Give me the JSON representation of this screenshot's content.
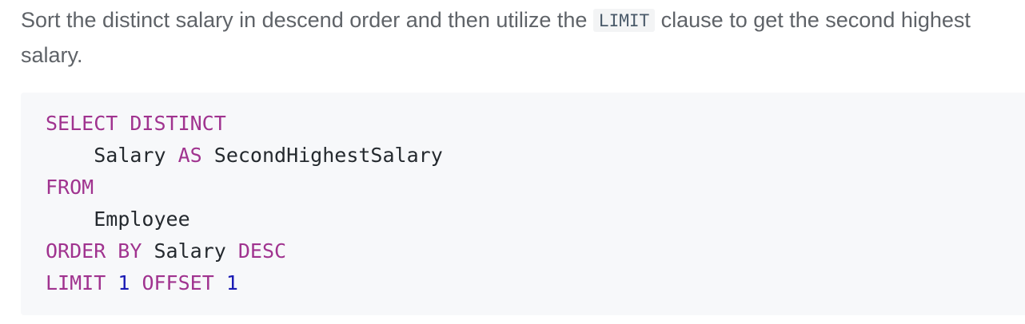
{
  "description": {
    "text_before": "Sort the distinct salary in descend order and then utilize the ",
    "inline_code": "LIMIT",
    "text_after": " clause to get the second highest salary."
  },
  "code": {
    "line1": {
      "kw1": "SELECT",
      "sp1": " ",
      "kw2": "DISTINCT"
    },
    "line2": {
      "indent": "    ",
      "ident1": "Salary",
      "sp1": " ",
      "kw1": "AS",
      "sp2": " ",
      "ident2": "SecondHighestSalary"
    },
    "line3": {
      "kw1": "FROM"
    },
    "line4": {
      "indent": "    ",
      "ident1": "Employee"
    },
    "line5": {
      "kw1": "ORDER BY",
      "sp1": " ",
      "ident1": "Salary",
      "sp2": " ",
      "kw2": "DESC"
    },
    "line6": {
      "kw1": "LIMIT",
      "sp1": " ",
      "num1": "1",
      "sp2": " ",
      "kw2": "OFFSET",
      "sp3": " ",
      "num2": "1"
    }
  },
  "colors": {
    "keyword": "#a0338f",
    "number": "#1a1ab4",
    "text": "#24292e",
    "code_background": "#f7f8fa",
    "paragraph_text": "#5f6368"
  }
}
